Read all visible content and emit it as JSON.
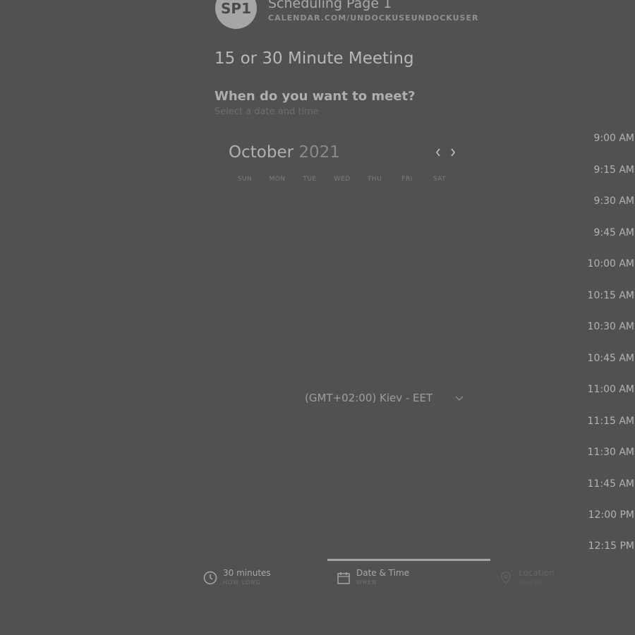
{
  "header": {
    "avatar_initials": "SP1",
    "page_name": "Scheduling Page 1",
    "page_url": "CALENDAR.COM/UNDOCKUSEUNDOCKUSER"
  },
  "meeting": {
    "title": "15 or 30 Minute Meeting",
    "prompt": "When do you want to meet?",
    "prompt_sub": "Select a date and time"
  },
  "calendar": {
    "month": "October",
    "year": "2021",
    "prev_icon": "chevron-left-icon",
    "next_icon": "chevron-right-icon",
    "weekdays": [
      "SUN",
      "MON",
      "TUE",
      "WED",
      "THU",
      "FRI",
      "SAT"
    ]
  },
  "timezone": {
    "value": "(GMT+02:00) Kiev - EET",
    "icon": "chevron-down-icon"
  },
  "time_slots": [
    "9:00 AM",
    "9:15 AM",
    "9:30 AM",
    "9:45 AM",
    "10:00 AM",
    "10:15 AM",
    "10:30 AM",
    "10:45 AM",
    "11:00 AM",
    "11:15 AM",
    "11:30 AM",
    "11:45 AM",
    "12:00 PM",
    "12:15 PM"
  ],
  "steps": {
    "duration": {
      "label": "30 minutes",
      "sublabel": "HOW LONG",
      "icon": "clock-icon"
    },
    "datetime": {
      "label": "Date & Time",
      "sublabel": "WHEN",
      "icon": "calendar-icon"
    },
    "location": {
      "label": "Location",
      "sublabel": "WHERE",
      "icon": "location-pin-icon"
    }
  },
  "colors": {
    "background": "#515151",
    "progress": "#a4a4a4"
  }
}
